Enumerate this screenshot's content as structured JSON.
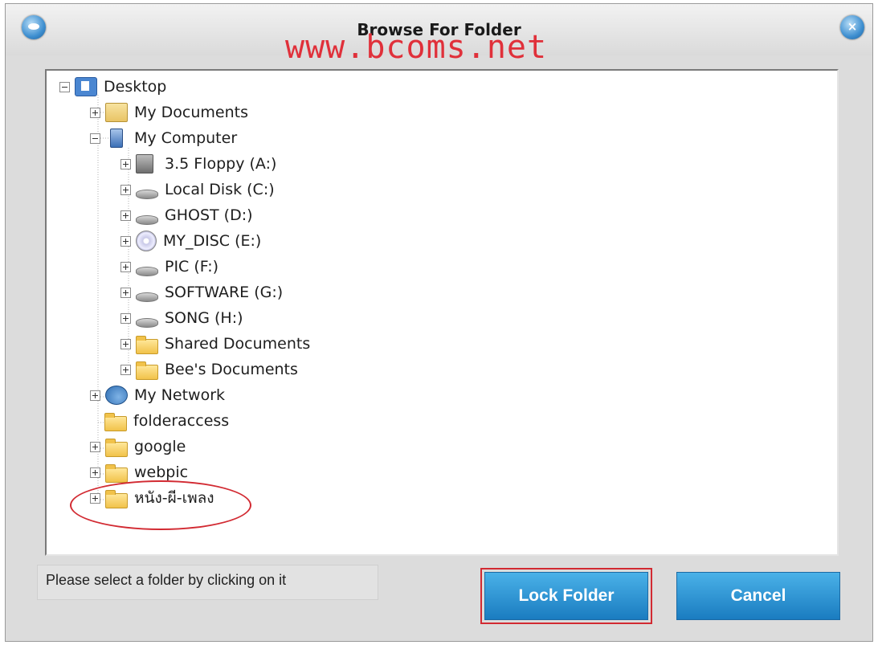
{
  "window": {
    "title": "Browse For Folder",
    "watermark": "www.bcoms.net"
  },
  "tree": {
    "items": [
      {
        "label": "Desktop",
        "icon": "desktop-icon",
        "expander": "minus"
      },
      {
        "label": "My Documents",
        "icon": "my-documents-icon",
        "expander": "plus"
      },
      {
        "label": "My Computer",
        "icon": "computer-icon",
        "expander": "minus"
      },
      {
        "label": "3.5 Floppy (A:)",
        "icon": "floppy-drive-icon",
        "expander": "plus"
      },
      {
        "label": "Local Disk (C:)",
        "icon": "hard-drive-icon",
        "expander": "plus"
      },
      {
        "label": "GHOST (D:)",
        "icon": "hard-drive-icon",
        "expander": "plus"
      },
      {
        "label": "MY_DISC (E:)",
        "icon": "cd-drive-icon",
        "expander": "plus"
      },
      {
        "label": "PIC (F:)",
        "icon": "hard-drive-icon",
        "expander": "plus"
      },
      {
        "label": "SOFTWARE (G:)",
        "icon": "hard-drive-icon",
        "expander": "plus"
      },
      {
        "label": "SONG (H:)",
        "icon": "hard-drive-icon",
        "expander": "plus"
      },
      {
        "label": "Shared Documents",
        "icon": "folder-icon",
        "expander": "plus"
      },
      {
        "label": "Bee's Documents",
        "icon": "folder-icon",
        "expander": "plus"
      },
      {
        "label": "My Network",
        "icon": "network-icon",
        "expander": "plus"
      },
      {
        "label": "folderaccess",
        "icon": "folder-icon",
        "expander": "none"
      },
      {
        "label": "google",
        "icon": "folder-icon",
        "expander": "plus"
      },
      {
        "label": "webpic",
        "icon": "folder-icon",
        "expander": "plus"
      },
      {
        "label": "หนัง-ผี-เพลง",
        "icon": "folder-icon",
        "expander": "plus"
      }
    ]
  },
  "status_text": "Please select a folder by clicking on it",
  "buttons": {
    "lock": "Lock Folder",
    "cancel": "Cancel"
  },
  "colors": {
    "button": "#2a8fd0",
    "highlight": "#d22a32",
    "watermark": "#e0303a"
  }
}
